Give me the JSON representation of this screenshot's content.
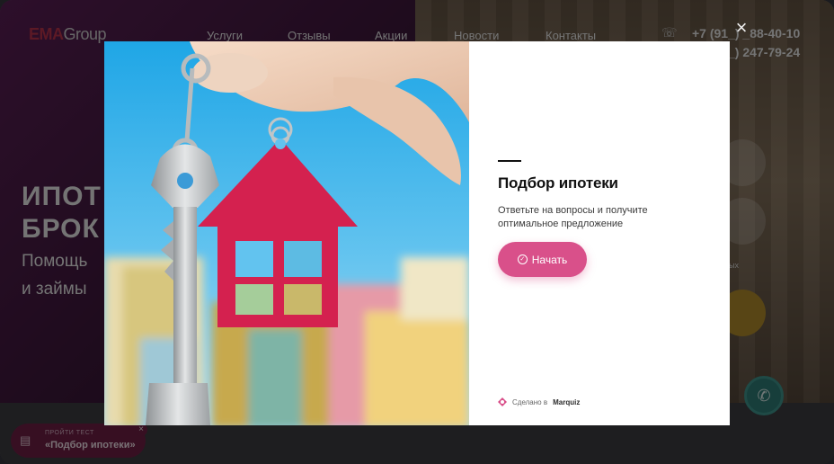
{
  "site": {
    "logo_main": "EMA",
    "logo_sub": "Group",
    "nav": [
      "Услуги",
      "Отзывы",
      "Акции",
      "Новости",
      "Контакты"
    ],
    "phone_1": "+7 (91_) _88-40-10",
    "phone_2": "_) 247-79-24",
    "hero_line_1": "ИПОТ",
    "hero_line_2": "БРОК",
    "hero_sub_1": "Помощь",
    "hero_sub_2": "и займы",
    "side_text": "ных"
  },
  "quiz_button": {
    "small_label": "пройти тест",
    "label": "«Подбор ипотеки»",
    "close": "×"
  },
  "modal": {
    "close": "×",
    "title": "Подбор ипотеки",
    "description": "Ответьте на вопросы и получите оптимальное предложение",
    "start_button": "Начать",
    "made_with_prefix": "Сделано в",
    "made_with_brand": "Marquiz"
  },
  "icons": {
    "phone": "phone-icon",
    "call": "call-icon",
    "check": "check-circle-icon",
    "marquiz": "marquiz-logo-icon",
    "test": "document-icon"
  },
  "colors": {
    "accent": "#d9508a",
    "brand": "#b8324a",
    "call": "#2f7d77"
  }
}
